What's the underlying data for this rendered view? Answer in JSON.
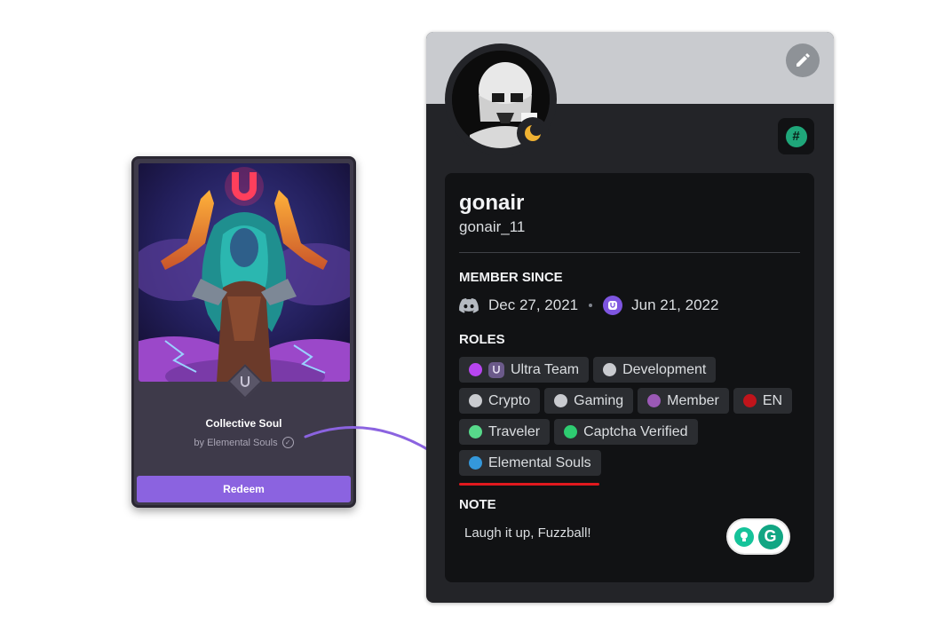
{
  "nft": {
    "title": "Collective Soul",
    "creator": "by Elemental Souls",
    "redeem_label": "Redeem"
  },
  "profile": {
    "display_name": "gonair",
    "username": "gonair_11",
    "member_since_title": "MEMBER SINCE",
    "discord_date": "Dec 27, 2021",
    "server_date": "Jun 21, 2022",
    "roles_title": "ROLES",
    "roles": [
      {
        "label": "Ultra Team",
        "color": "#b845f0"
      },
      {
        "label": "Development",
        "color": "#c9cbcf"
      },
      {
        "label": "Crypto",
        "color": "#c9cbcf"
      },
      {
        "label": "Gaming",
        "color": "#c9cbcf"
      },
      {
        "label": "Member",
        "color": "#9b59b6"
      },
      {
        "label": "EN",
        "color": "#c0141b"
      },
      {
        "label": "Traveler",
        "color": "#57d98a"
      },
      {
        "label": "Captcha Verified",
        "color": "#2ecc71"
      },
      {
        "label": "Elemental Souls",
        "color": "#3498db"
      }
    ],
    "note_title": "NOTE",
    "note_text": "Laugh it up, Fuzzball!",
    "icons": {
      "edit": "pencil-icon",
      "status": "moon-icon",
      "badge": "hashtag-icon",
      "discord": "discord-icon",
      "server": "ultra-logo-icon",
      "grammarly_bulb": "lightbulb-icon",
      "grammarly_logo": "grammarly-icon"
    }
  },
  "colors": {
    "accent_purple": "#8b63e0",
    "highlight_red": "#e0191e",
    "card_bg": "#232428",
    "inner_bg": "#111214"
  }
}
